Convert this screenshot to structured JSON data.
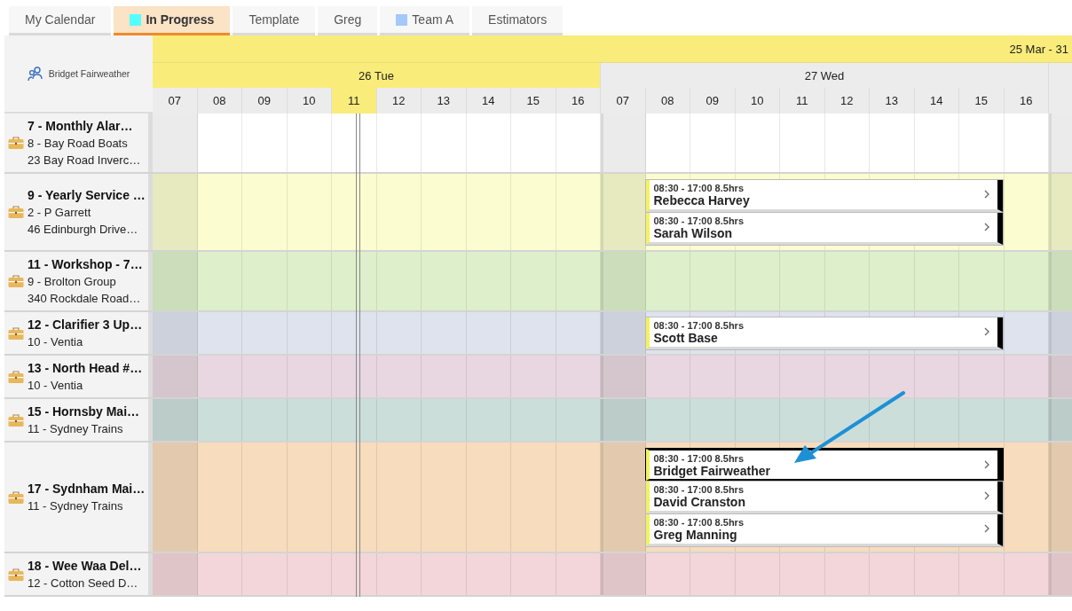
{
  "tabs": [
    {
      "label": "My Calendar",
      "selected": false
    },
    {
      "label": "In Progress",
      "selected": true,
      "color": "#55ffff"
    },
    {
      "label": "Template",
      "selected": false
    },
    {
      "label": "Greg",
      "selected": false
    },
    {
      "label": "Team A",
      "selected": false,
      "color": "#a4c8fa"
    },
    {
      "label": "Estimators",
      "selected": false
    }
  ],
  "resource": {
    "name": "Bridget Fairweather"
  },
  "week": {
    "label": "25 Mar - 31"
  },
  "days": [
    {
      "label": "26 Tue",
      "current": true,
      "hours": [
        {
          "label": "07",
          "current": false
        },
        {
          "label": "08",
          "current": false
        },
        {
          "label": "09",
          "current": false
        },
        {
          "label": "10",
          "current": false
        },
        {
          "label": "11",
          "current": true
        },
        {
          "label": "12",
          "current": false
        },
        {
          "label": "13",
          "current": false
        },
        {
          "label": "14",
          "current": false
        },
        {
          "label": "15",
          "current": false
        },
        {
          "label": "16",
          "current": false
        }
      ]
    },
    {
      "label": "27 Wed",
      "current": false,
      "hours": [
        {
          "label": "07",
          "current": false
        },
        {
          "label": "08",
          "current": false
        },
        {
          "label": "09",
          "current": false
        },
        {
          "label": "10",
          "current": false
        },
        {
          "label": "11",
          "current": false
        },
        {
          "label": "12",
          "current": false
        },
        {
          "label": "13",
          "current": false
        },
        {
          "label": "14",
          "current": false
        },
        {
          "label": "15",
          "current": false
        },
        {
          "label": "16",
          "current": false
        }
      ]
    }
  ],
  "jobs": [
    {
      "title": "7 - Monthly Alar…",
      "client": "8 - Bay Road Boats",
      "address": "23 Bay Road Inverc…",
      "color": "#ffffff"
    },
    {
      "title": "9 - Yearly Service …",
      "client": "2 - P Garrett",
      "address": "46 Edinburgh Drive…",
      "color": "#fbfdd0",
      "events": [
        {
          "time": "08:30 - 17:00 8.5hrs",
          "name": "Rebecca Harvey",
          "selected": false
        },
        {
          "time": "08:30 - 17:00 8.5hrs",
          "name": "Sarah Wilson",
          "selected": false
        }
      ]
    },
    {
      "title": "11 - Workshop - 7…",
      "client": "9 - Brolton Group",
      "address": "340 Rockdale Road…",
      "color": "#ddf0cb"
    },
    {
      "title": "12 - Clarifier 3 Up…",
      "client": "10 - Ventia",
      "color": "#dee3ee",
      "events": [
        {
          "time": "08:30 - 17:00 8.5hrs",
          "name": "Scott Base",
          "selected": false
        }
      ]
    },
    {
      "title": "13 - North Head #…",
      "client": "10 - Ventia",
      "color": "#e8d7e0"
    },
    {
      "title": "15 - Hornsby Mai…",
      "client": "11 - Sydney Trains",
      "color": "#ccdeda"
    },
    {
      "title": "17 - Sydnham Mai…",
      "client": "11 - Sydney Trains",
      "color": "#f7dcbd",
      "events": [
        {
          "time": "08:30 - 17:00 8.5hrs",
          "name": "Bridget Fairweather",
          "selected": true
        },
        {
          "time": "08:30 - 17:00 8.5hrs",
          "name": "David Cranston",
          "selected": false
        },
        {
          "time": "08:30 - 17:00 8.5hrs",
          "name": "Greg Manning",
          "selected": false
        }
      ]
    },
    {
      "title": "18 - Wee Waa Del…",
      "client": "12 - Cotton Seed D…",
      "color": "#f3d6d9"
    }
  ]
}
